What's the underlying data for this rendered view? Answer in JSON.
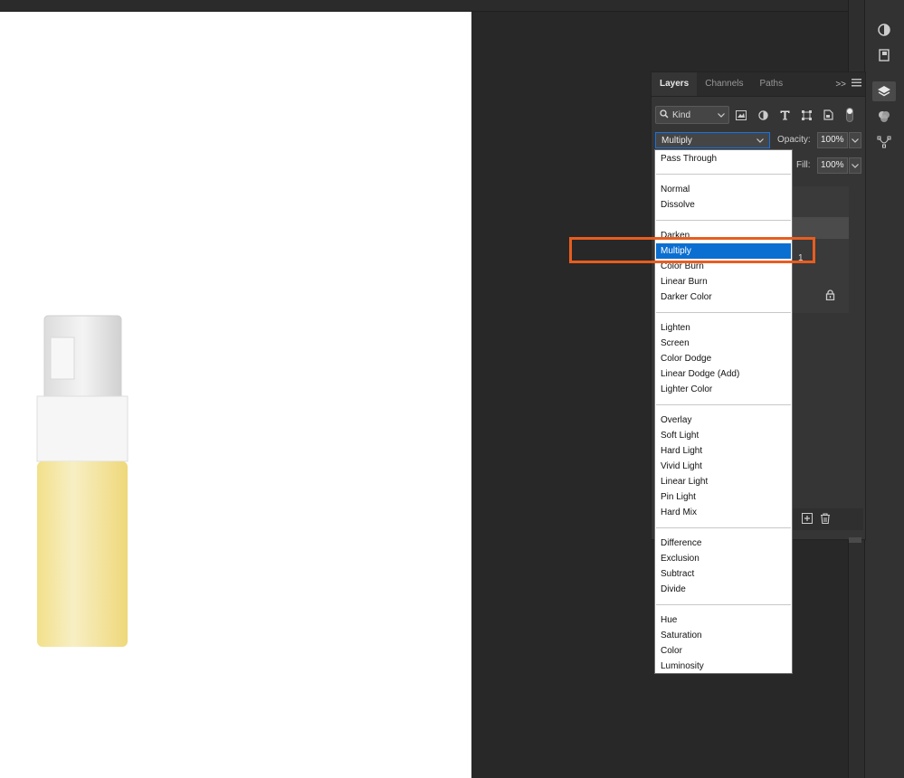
{
  "panel": {
    "tabs": [
      "Layers",
      "Channels",
      "Paths"
    ],
    "expand_glyph": ">>",
    "filter": {
      "kind_label": "Kind"
    },
    "blend_mode": {
      "value": "Multiply"
    },
    "opacity": {
      "label": "Opacity:",
      "value": "100%"
    },
    "fill": {
      "label": "Fill:",
      "value": "100%"
    },
    "layer_partial_label": "1"
  },
  "blend_menu": {
    "groups": [
      [
        "Pass Through"
      ],
      [
        "Normal",
        "Dissolve"
      ],
      [
        "Darken",
        "Multiply",
        "Color Burn",
        "Linear Burn",
        "Darker Color"
      ],
      [
        "Lighten",
        "Screen",
        "Color Dodge",
        "Linear Dodge (Add)",
        "Lighter Color"
      ],
      [
        "Overlay",
        "Soft Light",
        "Hard Light",
        "Vivid Light",
        "Linear Light",
        "Pin Light",
        "Hard Mix"
      ],
      [
        "Difference",
        "Exclusion",
        "Subtract",
        "Divide"
      ],
      [
        "Hue",
        "Saturation",
        "Color",
        "Luminosity"
      ]
    ],
    "selected": "Multiply"
  },
  "colors": {
    "accent": "#0b6fd1",
    "highlight_box": "#e85d1f"
  }
}
